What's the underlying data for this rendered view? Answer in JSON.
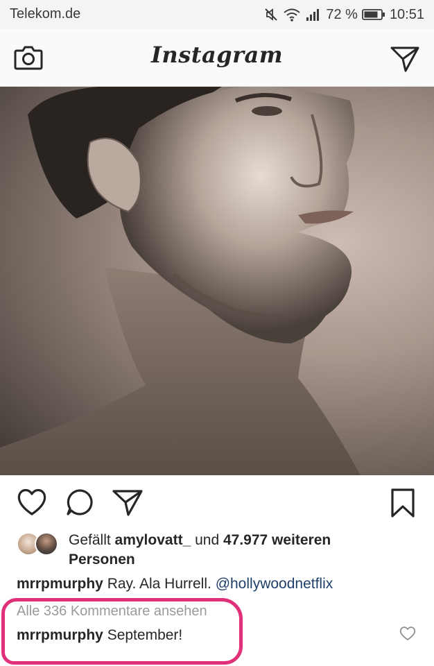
{
  "status_bar": {
    "carrier": "Telekom.de",
    "battery_percent": "72 %",
    "time": "10:51",
    "icons": [
      "mute-icon",
      "wifi-icon",
      "signal-icon",
      "battery-icon"
    ]
  },
  "header": {
    "title": "Instagram",
    "icons": [
      "camera-icon",
      "direct-message-icon"
    ]
  },
  "post": {
    "image_alt": "sepia portrait of a man in profile",
    "actions": [
      "heart-icon",
      "comment-icon",
      "share-icon",
      "bookmark-icon"
    ],
    "likes": {
      "prefix": "Gefällt ",
      "user": "amylovatt_",
      "middle": " und ",
      "count": "47.977 weiteren",
      "suffix": "Personen"
    },
    "caption": {
      "user": "mrrpmurphy",
      "text": " Ray. Ala Hurrell. ",
      "mention": "@hollywoodnetflix"
    },
    "view_all_comments": "Alle 336 Kommentare ansehen",
    "comment": {
      "user": "mrrpmurphy",
      "text": " September!"
    }
  },
  "colors": {
    "text": "#262626",
    "link": "#1e3f6a",
    "muted": "#9a9a9a",
    "highlight": "#e0307a"
  }
}
